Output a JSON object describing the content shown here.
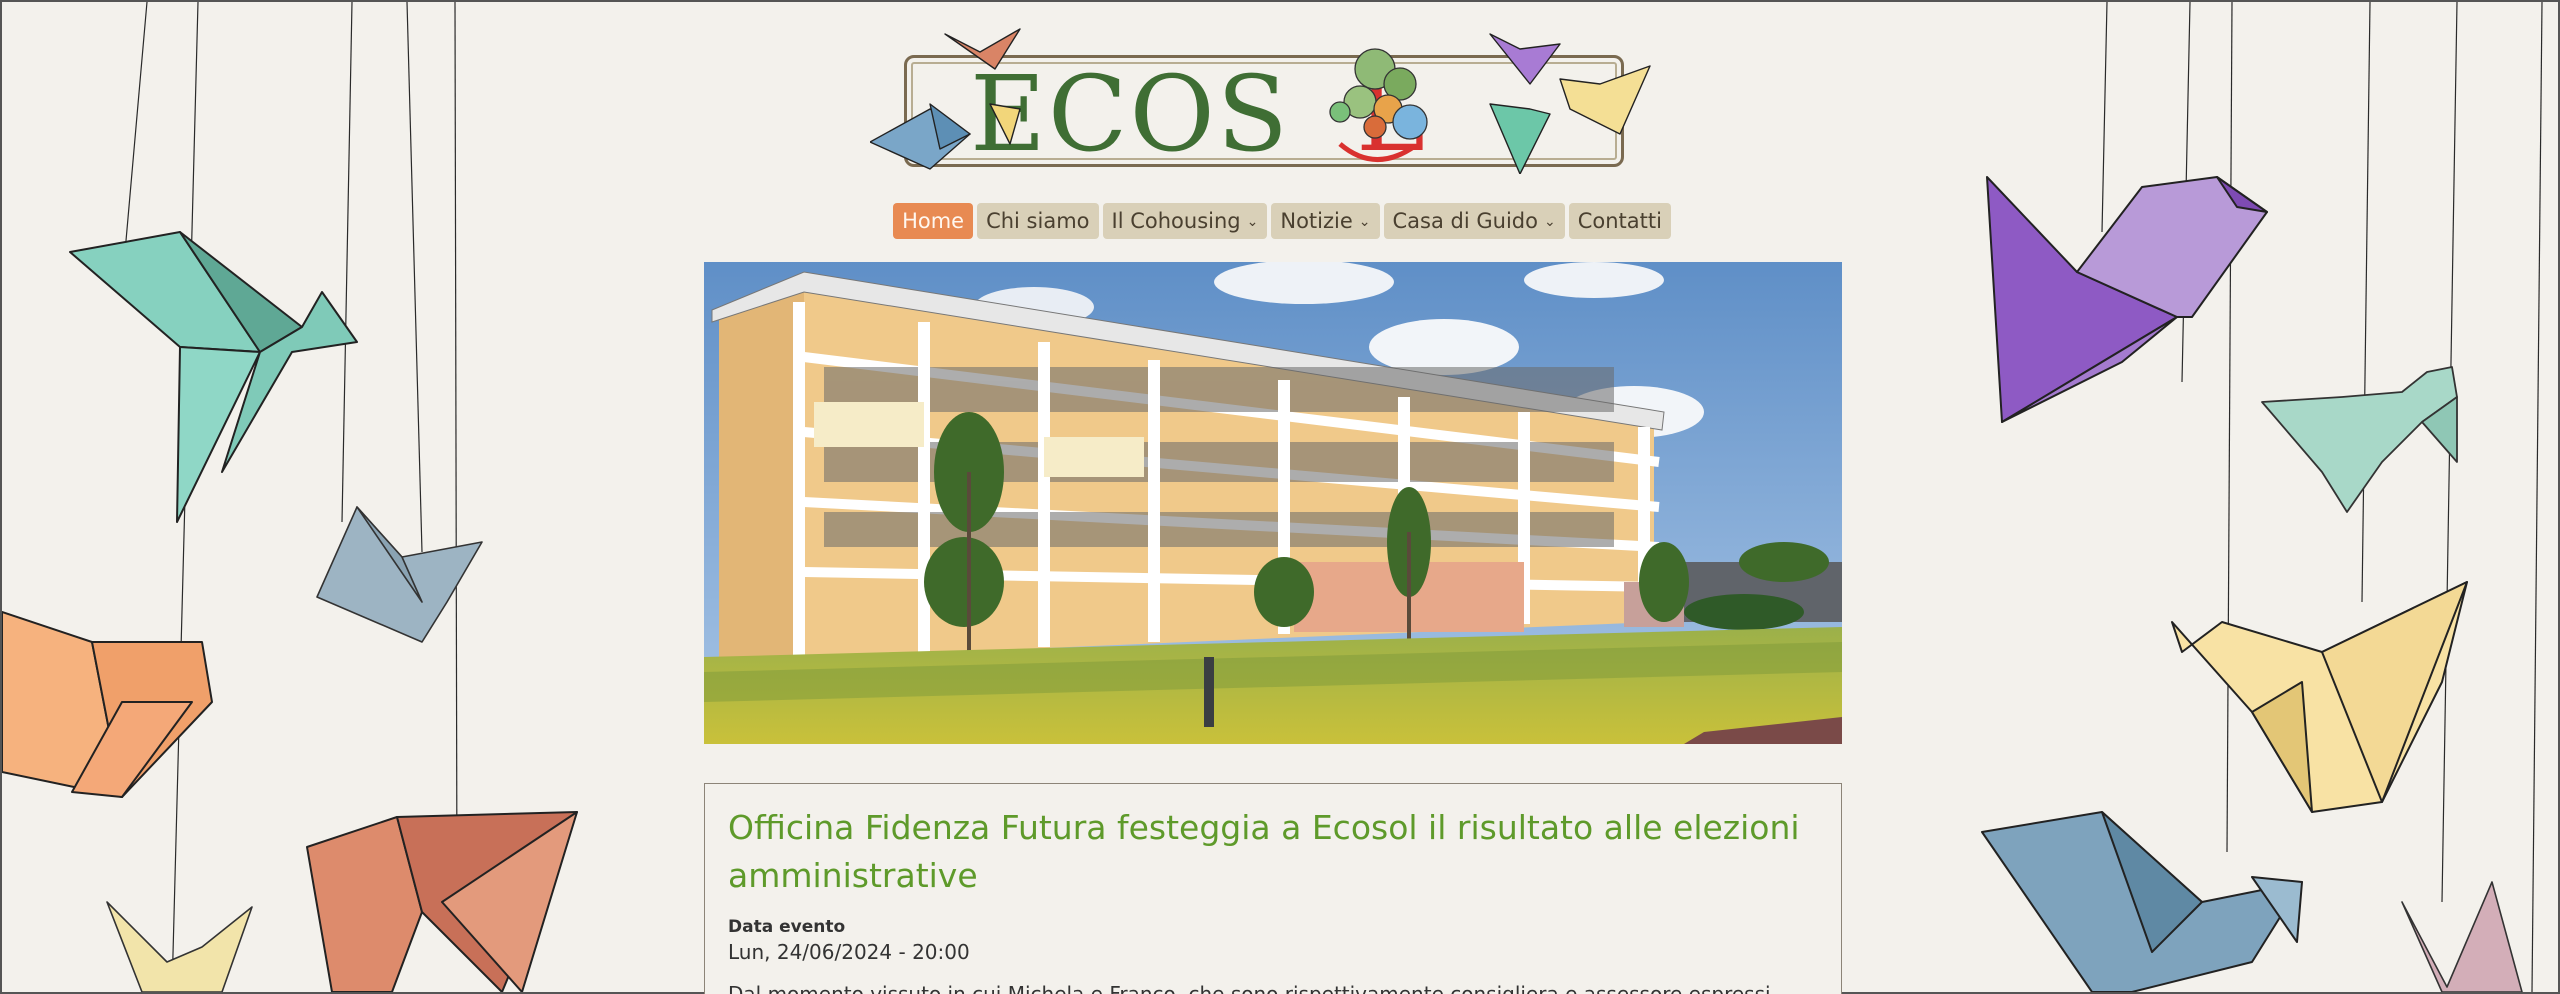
{
  "logo": {
    "text_part1": "ECOS",
    "text_part2": "L",
    "colors": {
      "green": "#3f6e34",
      "red": "#d9312f"
    }
  },
  "nav": {
    "items": [
      {
        "label": "Home",
        "active": true,
        "dropdown": false
      },
      {
        "label": "Chi siamo",
        "active": false,
        "dropdown": false
      },
      {
        "label": "Il Cohousing",
        "active": false,
        "dropdown": true
      },
      {
        "label": "Notizie",
        "active": false,
        "dropdown": true
      },
      {
        "label": "Casa di Guido",
        "active": false,
        "dropdown": true
      },
      {
        "label": "Contatti",
        "active": false,
        "dropdown": false
      }
    ],
    "chevron_icon": "chevron-down-icon",
    "colors": {
      "active_bg": "#e88a52",
      "item_bg": "#d9d0b8"
    }
  },
  "hero": {
    "icon": "building-photo"
  },
  "article": {
    "title": "Officina Fidenza Futura festeggia a Ecosol il risultato alle elezioni amministrative",
    "event_label": "Data evento",
    "event_date": "Lun, 24/06/2024 - 20:00",
    "body_preview": "Dal momento vissuto in cui Michela e Franco, che sono rispettivamente consigliera e assessore espressi",
    "title_color": "#5e9a2a"
  }
}
